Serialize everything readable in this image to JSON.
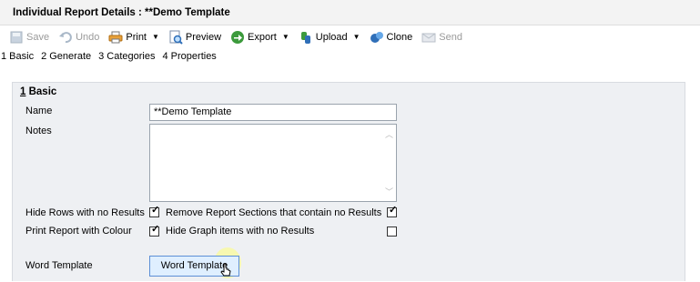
{
  "window": {
    "title": "Individual Report Details : **Demo Template"
  },
  "toolbar": {
    "save": "Save",
    "undo": "Undo",
    "print": "Print",
    "preview": "Preview",
    "export": "Export",
    "upload": "Upload",
    "clone": "Clone",
    "send": "Send"
  },
  "tabs": [
    "1 Basic",
    "2 Generate",
    "3 Categories",
    "4 Properties"
  ],
  "section": {
    "number": "1",
    "title": " Basic"
  },
  "form": {
    "name_label": "Name",
    "name_value": "**Demo Template",
    "notes_label": "Notes",
    "notes_value": "",
    "hide_rows_label": "Hide Rows with no Results",
    "hide_rows_checked": true,
    "remove_sections_label": "Remove Report Sections that contain no Results",
    "remove_sections_checked": true,
    "print_colour_label": "Print Report with Colour",
    "print_colour_checked": true,
    "hide_graph_label": "Hide Graph items with no Results",
    "hide_graph_checked": false,
    "word_template_label": "Word Template",
    "word_template_button": "Word Template"
  },
  "icons": {
    "save": "save-icon",
    "undo": "undo-icon",
    "print": "print-icon",
    "preview": "preview-icon",
    "export": "export-icon",
    "upload": "upload-icon",
    "clone": "clone-icon",
    "send": "send-icon"
  },
  "colors": {
    "section_bg": "#eef0f3",
    "button_bg": "#dfefff",
    "button_border": "#5c8fd6"
  }
}
